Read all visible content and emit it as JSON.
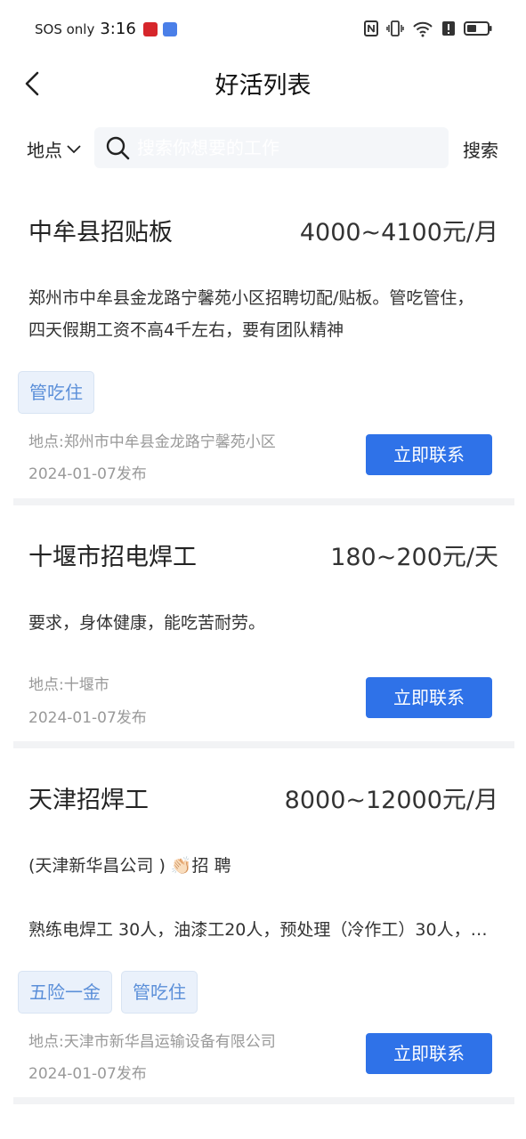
{
  "status_bar": {
    "carrier": "SOS only",
    "time": "3:16",
    "icons": [
      "nfc-icon",
      "vibrate-icon",
      "wifi-icon",
      "alert-icon",
      "battery-icon"
    ]
  },
  "header": {
    "title": "好活列表",
    "back_icon": "chevron-left-icon"
  },
  "search": {
    "location_label": "地点",
    "placeholder": "搜索你想要的工作",
    "button_label": "搜索"
  },
  "jobs": [
    {
      "title": "中牟县招贴板",
      "salary": "4000~4100元/月",
      "desc_lines": [
        "郑州市中牟县金龙路宁馨苑小区招聘切配/贴板。管吃管住，",
        "四天假期工资不高4千左右，要有团队精神"
      ],
      "tags": [
        "管吃住"
      ],
      "location": "地点:郑州市中牟县金龙路宁馨苑小区",
      "date": "2024-01-07发布",
      "button": "立即联系"
    },
    {
      "title": "十堰市招电焊工",
      "salary": "180~200元/天",
      "desc_lines": [
        "要求，身体健康，能吃苦耐劳。"
      ],
      "tags": [],
      "location": "地点:十堰市",
      "date": "2024-01-07发布",
      "button": "立即联系"
    },
    {
      "title": "天津招焊工",
      "salary": "8000~12000元/月",
      "desc_lines": [
        "(天津新华昌公司 ) 👏🏻招 聘",
        "",
        "熟练电焊工 30人，油漆工20人，预处理（冷作工）30人，…"
      ],
      "tags": [
        "五险一金",
        "管吃住"
      ],
      "location": "地点:天津市新华昌运输设备有限公司",
      "date": "2024-01-07发布",
      "button": "立即联系"
    }
  ],
  "colors": {
    "accent": "#2f72e8",
    "tag_bg": "#eaf1fb",
    "tag_text": "#5b8fd9",
    "meta_text": "#999999"
  }
}
